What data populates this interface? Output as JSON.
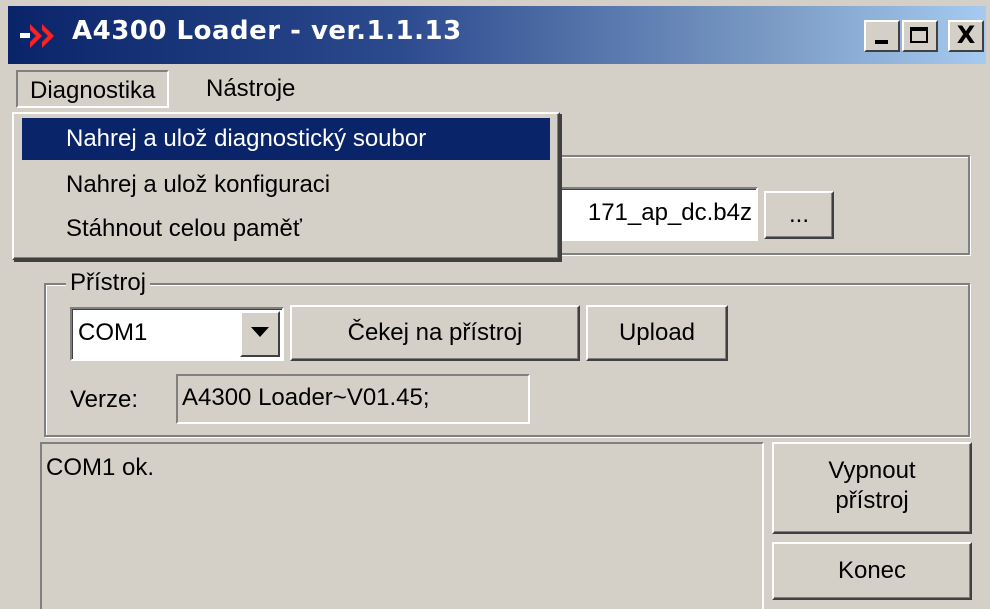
{
  "window": {
    "title": "A4300 Loader - ver.1.1.13",
    "controls": {
      "minimize": "_",
      "maximize": "□",
      "close": "X"
    }
  },
  "menubar": {
    "items": [
      {
        "label": "Diagnostika",
        "open": true
      },
      {
        "label": "Nástroje"
      }
    ]
  },
  "dropdown": {
    "items": [
      {
        "label": "Nahrej a ulož diagnostický soubor",
        "selected": true
      },
      {
        "label": "Nahrej a ulož konfiguraci"
      },
      {
        "label": "Stáhnout celou paměť"
      }
    ]
  },
  "file": {
    "value": "171_ap_dc.b4z",
    "browse_label": "..."
  },
  "device": {
    "group_label": "Přístroj",
    "port": "COM1",
    "wait_button": "Čekej na přístroj",
    "upload_button": "Upload",
    "version_label": "Verze:",
    "version_value": "A4300 Loader~V01.45;"
  },
  "log": {
    "text": "COM1 ok."
  },
  "actions": {
    "power_off_line1": "Vypnout",
    "power_off_line2": "přístroj",
    "exit": "Konec"
  },
  "colors": {
    "titlebar_start": "#0a246a",
    "titlebar_end": "#a6caf0",
    "face": "#d4d0c8",
    "selection": "#0a246a"
  }
}
